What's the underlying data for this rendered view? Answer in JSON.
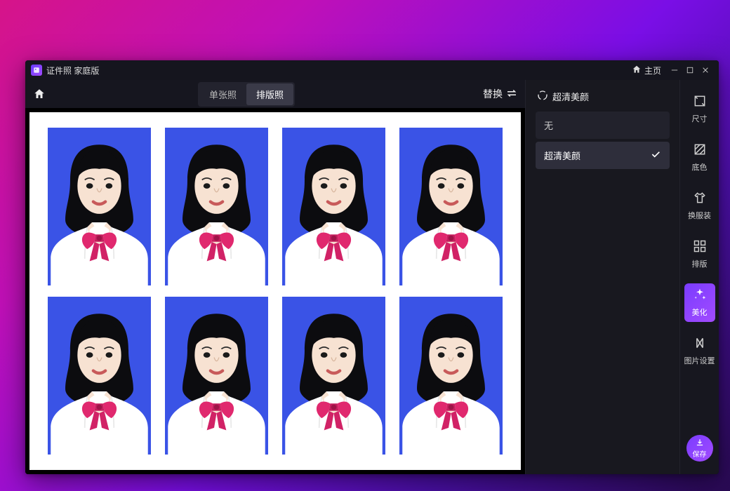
{
  "titlebar": {
    "app_title": "证件照 家庭版",
    "home_label": "主页"
  },
  "toolbar": {
    "tab_single": "单张照",
    "tab_sheet": "排版照",
    "active_tab": "sheet",
    "swap_label": "替换"
  },
  "panel": {
    "title": "超清美颜",
    "options": [
      {
        "label": "无",
        "selected": false
      },
      {
        "label": "超清美颜",
        "selected": true
      }
    ]
  },
  "nav": {
    "items": [
      {
        "id": "size",
        "label": "尺寸"
      },
      {
        "id": "bg",
        "label": "底色"
      },
      {
        "id": "outfit",
        "label": "换服装"
      },
      {
        "id": "layout",
        "label": "排版"
      },
      {
        "id": "beautify",
        "label": "美化",
        "active": true
      },
      {
        "id": "imgset",
        "label": "图片设置"
      }
    ],
    "save_label": "保存"
  },
  "canvas": {
    "rows": 2,
    "cols": 4,
    "photo_bg": "#3a53e6"
  }
}
